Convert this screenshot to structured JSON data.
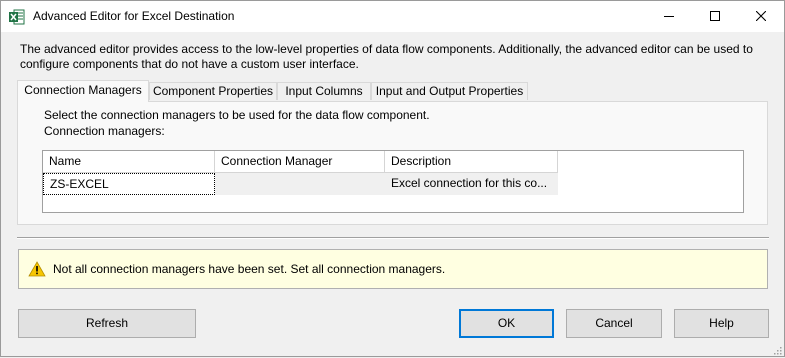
{
  "window": {
    "title": "Advanced Editor for Excel Destination",
    "app_icon": "excel-icon",
    "controls": [
      "minimize-icon",
      "maximize-icon",
      "close-icon"
    ]
  },
  "description": "The advanced editor provides access to the low-level properties of data flow components. Additionally, the advanced editor can be used to configure components that do not have a custom user interface.",
  "tabs": [
    {
      "label": "Connection Managers",
      "active": true
    },
    {
      "label": "Component Properties",
      "active": false
    },
    {
      "label": "Input Columns",
      "active": false
    },
    {
      "label": "Input and Output Properties",
      "active": false
    }
  ],
  "panel": {
    "instruction": "Select the connection managers to be used for the data flow component.",
    "grid_label": "Connection managers:"
  },
  "grid": {
    "columns": [
      "Name",
      "Connection Manager",
      "Description"
    ],
    "rows": [
      {
        "name": "ZS-EXCEL",
        "connection_manager": "",
        "description": "Excel connection for this co..."
      }
    ]
  },
  "warning": {
    "icon": "warning-icon",
    "text": "Not all connection managers have been set. Set all connection managers."
  },
  "buttons": {
    "refresh": "Refresh",
    "ok": "OK",
    "cancel": "Cancel",
    "help": "Help"
  },
  "colors": {
    "warning_bg": "#ffffe1",
    "default_button_border": "#0078d7"
  }
}
